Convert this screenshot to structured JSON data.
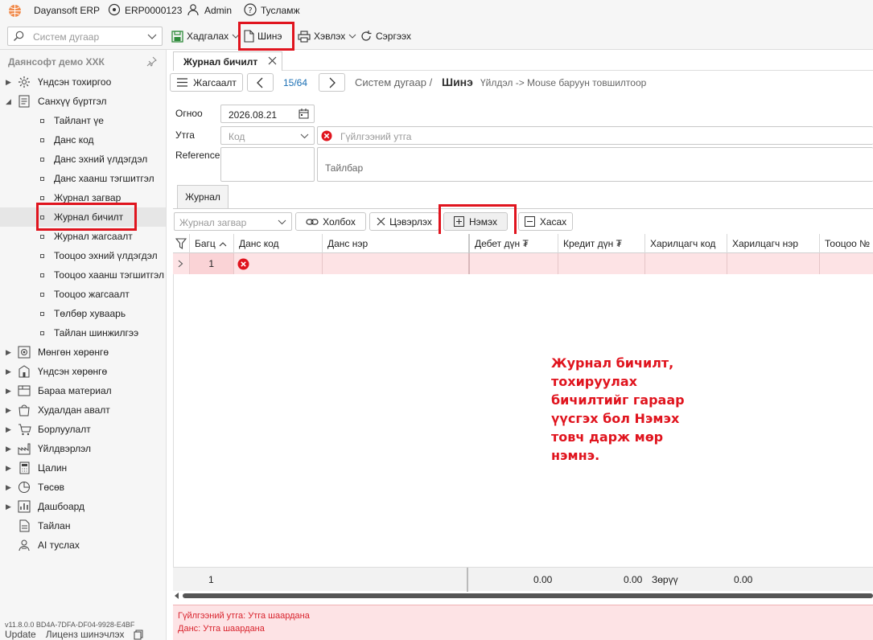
{
  "app": {
    "name": "Dayansoft ERP",
    "code": "ERP0000123",
    "user": "Admin",
    "help": "Тусламж"
  },
  "toolbar": {
    "search_placeholder": "Систем дугаар",
    "save": "Хадгалах",
    "new": "Шинэ",
    "print": "Хэвлэх",
    "refresh": "Сэргээх"
  },
  "sidebar": {
    "company": "Даянсофт демо ХХК",
    "items": [
      {
        "label": "Үндсэн тохиргоо",
        "icon": "gear-icon",
        "expanded": false
      },
      {
        "label": "Санхүү бүртгэл",
        "icon": "ledger-icon",
        "expanded": true
      },
      {
        "label": "Мөнгөн хөрөнгө",
        "icon": "cash-icon",
        "expanded": false
      },
      {
        "label": "Үндсэн хөрөнгө",
        "icon": "building-icon",
        "expanded": false
      },
      {
        "label": "Бараа материал",
        "icon": "box-icon",
        "expanded": false
      },
      {
        "label": "Худалдан авалт",
        "icon": "bag-icon",
        "expanded": false
      },
      {
        "label": "Борлуулалт",
        "icon": "cart-icon",
        "expanded": false
      },
      {
        "label": "Үйлдвэрлэл",
        "icon": "factory-icon",
        "expanded": false
      },
      {
        "label": "Цалин",
        "icon": "calculator-icon",
        "expanded": false
      },
      {
        "label": "Төсөв",
        "icon": "pie-icon",
        "expanded": false
      },
      {
        "label": "Дашбоард",
        "icon": "dashboard-icon",
        "expanded": false
      },
      {
        "label": "Тайлан",
        "icon": "report-icon",
        "expanded": false
      },
      {
        "label": "AI туслах",
        "icon": "assistant-icon",
        "expanded": false
      }
    ],
    "children": [
      "Тайлант үе",
      "Данс код",
      "Данс эхний үлдэгдэл",
      "Данс хаанш тэгшитгэл",
      "Журнал загвар",
      "Журнал бичилт",
      "Журнал жагсаалт",
      "Тооцоо эхний үлдэгдэл",
      "Тооцоо хаанш тэгшитгэл",
      "Тооцоо жагсаалт",
      "Төлбөр хуваарь",
      "Тайлан шинжилгээ"
    ],
    "version": "v11.8.0.0   BD4A-7DFA-DF04-9928-E4BF",
    "update": "Update",
    "license": "Лиценз шинэчлэх"
  },
  "doc": {
    "tab_title": "Журнал бичилт",
    "list_button": "Жагсаалт",
    "position": "15/64",
    "breadcrumb_prefix": "Систем дугаар /",
    "breadcrumb_current": "Шинэ",
    "hint": "Үйлдэл -> Mouse баруун товшилтоор"
  },
  "form": {
    "date_label": "Огноо",
    "date_value": "2026.08.21",
    "utga_label": "Утга",
    "code_placeholder": "Код",
    "txn_placeholder": "Гүйлгээний утга",
    "reference_label": "Reference",
    "note_placeholder": "Тайлбар"
  },
  "journal": {
    "tab": "Журнал",
    "template_placeholder": "Журнал загвар",
    "link": "Холбох",
    "clear": "Цэвэрлэх",
    "add": "Нэмэх",
    "delete": "Хасах"
  },
  "grid": {
    "columns": [
      "Багц",
      "Данс код",
      "Данс нэр",
      "Дебет дүн ₮",
      "Кредит дүн ₮",
      "Харилцагч код",
      "Харилцагч нэр",
      "Тооцоо №"
    ],
    "row": {
      "batch": "1"
    },
    "footer": {
      "count": "1",
      "debit": "0.00",
      "credit": "0.00",
      "diff_label": "Зөрүү",
      "diff": "0.00"
    }
  },
  "annotation": "Журнал бичилт, тохируулах бичилтийг гараар үүсгэх бол Нэмэх товч дарж мөр нэмнэ.",
  "errors": [
    "Гүйлгээний утга: Утга шаардана",
    "Данс: Утга шаардана"
  ],
  "colors": {
    "error": "#e0141e",
    "error_row": "#fde3e5",
    "accent": "#1a6fb4"
  }
}
